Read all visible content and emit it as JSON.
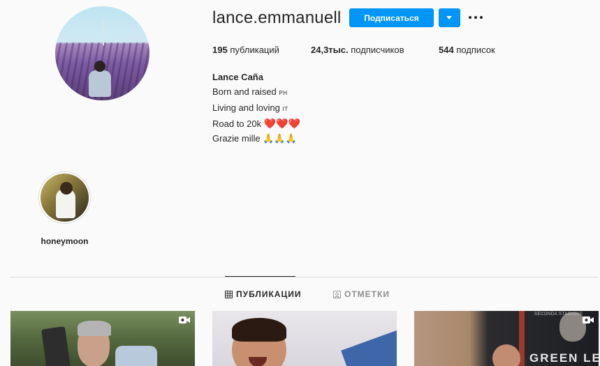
{
  "profile": {
    "username": "lance.emmanuell",
    "follow_label": "Подписаться",
    "stats": {
      "posts_count": "195",
      "posts_label": "публикаций",
      "followers_count": "24,3тыс.",
      "followers_label": "подписчиков",
      "following_count": "544",
      "following_label": "подписок"
    },
    "bio": {
      "full_name": "Lance Caña",
      "line1_text": "Born and raised",
      "line1_flag": "PH",
      "line2_text": "Living and loving",
      "line2_flag": "IT",
      "line3_text": "Road to 20k",
      "line3_emoji": "❤️❤️❤️",
      "line4_text": "Grazie mille",
      "line4_emoji": "🙏🙏🙏"
    }
  },
  "highlights": [
    {
      "label": "honeymoon"
    }
  ],
  "tabs": {
    "posts_label": "ПУБЛИКАЦИИ",
    "tagged_label": "ОТМЕТКИ",
    "active": "posts"
  },
  "posts": [
    {
      "type": "video",
      "icon": "video-icon"
    },
    {
      "type": "image",
      "icon": ""
    },
    {
      "type": "video",
      "icon": "video-icon"
    }
  ],
  "post_texts": {
    "tile3_small": "SECONDA STAGIONE",
    "tile3_title": "GREEN LEAF"
  },
  "colors": {
    "accent": "#0095f6",
    "text": "#262626",
    "muted": "#8e8e8e",
    "background": "#fafafa",
    "divider": "#dbdbdb"
  }
}
